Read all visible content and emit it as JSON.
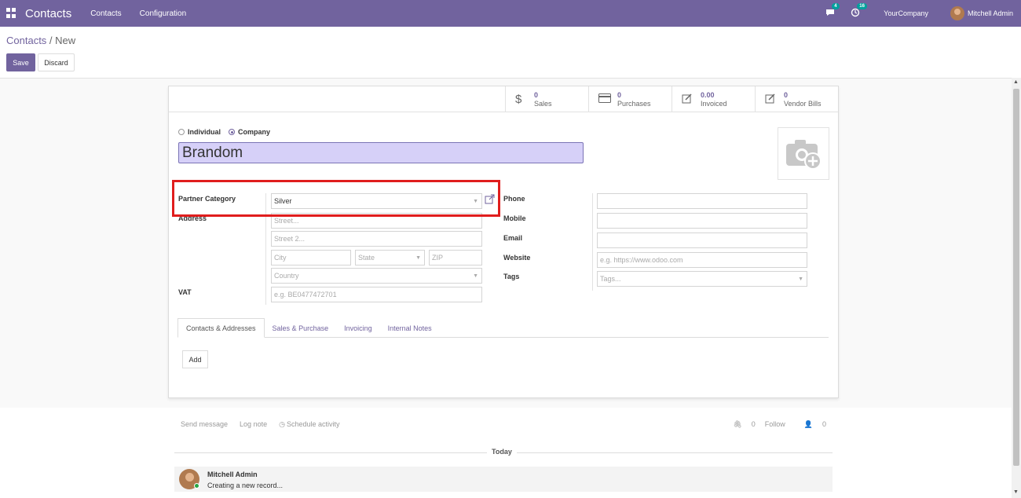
{
  "navbar": {
    "app_name": "Contacts",
    "menus": [
      "Contacts",
      "Configuration"
    ],
    "messages_count": "4",
    "activities_count": "16",
    "company": "YourCompany",
    "user": "Mitchell Admin",
    "bg_color": "#71639e"
  },
  "breadcrumb": {
    "parent": "Contacts",
    "separator": " / ",
    "current": "New"
  },
  "actions": {
    "save": "Save",
    "discard": "Discard"
  },
  "stat_buttons": [
    {
      "value": "0",
      "label": "Sales",
      "icon": "dollar-icon"
    },
    {
      "value": "0",
      "label": "Purchases",
      "icon": "credit-card-icon"
    },
    {
      "value": "0.00",
      "label": "Invoiced",
      "icon": "edit-icon"
    },
    {
      "value": "0",
      "label": "Vendor Bills",
      "icon": "edit-icon"
    }
  ],
  "company_type": {
    "individual": "Individual",
    "company": "Company",
    "selected": "Company"
  },
  "name": "Brandom",
  "left_fields": {
    "partner_category_label": "Partner Category",
    "partner_category_value": "Silver",
    "address_label": "Address",
    "street_placeholder": "Street...",
    "street2_placeholder": "Street 2...",
    "city_placeholder": "City",
    "state_placeholder": "State",
    "zip_placeholder": "ZIP",
    "country_placeholder": "Country",
    "vat_label": "VAT",
    "vat_placeholder": "e.g. BE0477472701"
  },
  "right_fields": {
    "phone_label": "Phone",
    "mobile_label": "Mobile",
    "email_label": "Email",
    "website_label": "Website",
    "website_placeholder": "e.g. https://www.odoo.com",
    "tags_label": "Tags",
    "tags_placeholder": "Tags..."
  },
  "tabs": [
    "Contacts & Addresses",
    "Sales & Purchase",
    "Invoicing",
    "Internal Notes"
  ],
  "add_button": "Add",
  "chatter": {
    "send_message": "Send message",
    "log_note": "Log note",
    "schedule_activity": "Schedule activity",
    "attachments_count": "0",
    "follow": "Follow",
    "followers_count": "0",
    "date_separator": "Today",
    "message_author": "Mitchell Admin",
    "message_body": "Creating a new record..."
  },
  "highlight_color": "#e01d1d"
}
